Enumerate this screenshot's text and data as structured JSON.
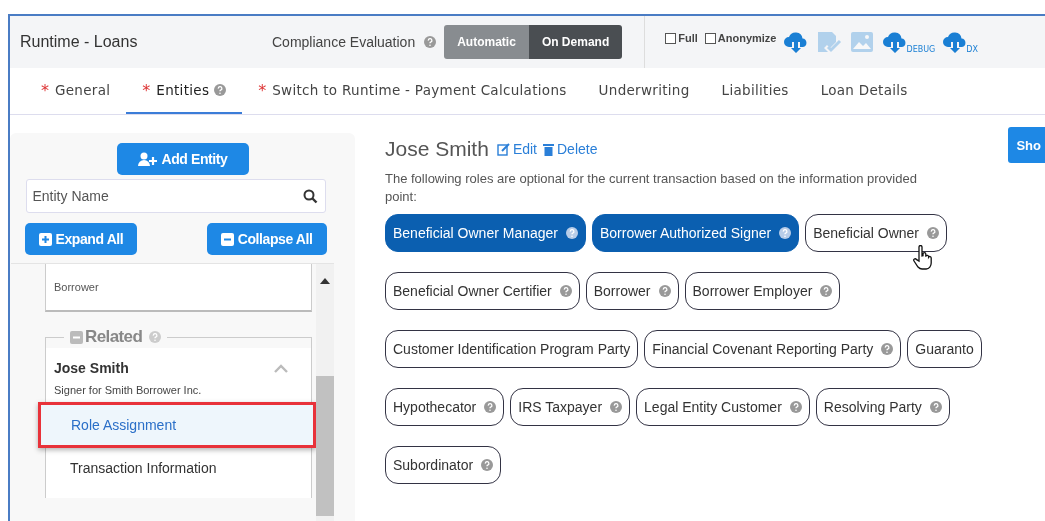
{
  "header": {
    "title": "Runtime - Loans",
    "compliance_label": "Compliance Evaluation",
    "modes": [
      {
        "label": "Automatic",
        "selected": false
      },
      {
        "label": "On Demand",
        "selected": true
      }
    ],
    "options": [
      {
        "label": "Full",
        "checked": false
      },
      {
        "label": "Anonymize",
        "checked": false
      }
    ],
    "tools": [
      {
        "kind": "cloud",
        "disabled": false
      },
      {
        "kind": "save",
        "disabled": true
      },
      {
        "kind": "image",
        "disabled": true
      },
      {
        "kind": "cloud",
        "caption": "DEBUG",
        "disabled": false
      },
      {
        "kind": "cloud",
        "caption": "DX",
        "disabled": false
      }
    ]
  },
  "tabs": [
    {
      "marker": "*",
      "label": "General",
      "help": false,
      "selected": false
    },
    {
      "marker": "*",
      "label": "Entities",
      "help": true,
      "selected": true
    },
    {
      "marker": "*",
      "label": "Switch to Runtime - Payment Calculations",
      "help": false,
      "selected": false
    },
    {
      "label": "Underwriting",
      "help": false,
      "selected": false
    },
    {
      "label": "Liabilities",
      "help": false,
      "selected": false
    },
    {
      "label": "Loan Details",
      "help": false,
      "selected": false
    }
  ],
  "sidebar": {
    "add_button": "Add Entity",
    "search": {
      "placeholder": "Entity Name"
    },
    "expand_button": "Expand All",
    "collapse_button": "Collapse All",
    "top_card": "Borrower",
    "group_label": "Related",
    "entity": {
      "name": "Jose Smith",
      "subtitle": "Signer for Smith Borrower Inc.",
      "expanded": true
    },
    "items": [
      {
        "label": "Role Assignment",
        "selected": true
      },
      {
        "label": "Transaction Information",
        "selected": false
      }
    ]
  },
  "main": {
    "name": "Jose Smith",
    "edit": "Edit",
    "delete": "Delete",
    "corner_button": "Sho",
    "description": "The following roles are optional for the current transaction based on the information provided",
    "description_2": "point:",
    "role_rows": [
      [
        {
          "label": "Beneficial Owner Manager",
          "selected": true,
          "help": true
        },
        {
          "label": "Borrower Authorized Signer",
          "selected": true,
          "help": true
        },
        {
          "label": "Beneficial Owner",
          "selected": false,
          "help": true
        }
      ],
      [
        {
          "label": "Beneficial Owner Certifier",
          "selected": false,
          "help": true
        },
        {
          "label": "Borrower",
          "selected": false,
          "help": true
        },
        {
          "label": "Borrower Employer",
          "selected": false,
          "help": true
        }
      ],
      [
        {
          "label": "Customer Identification Program Party",
          "selected": false,
          "help": false
        },
        {
          "label": "Financial Covenant Reporting Party",
          "selected": false,
          "help": true
        },
        {
          "label": "Guaranto",
          "selected": false,
          "help": false
        }
      ],
      [
        {
          "label": "Hypothecator",
          "selected": false,
          "help": true
        },
        {
          "label": "IRS Taxpayer",
          "selected": false,
          "help": true
        },
        {
          "label": "Legal Entity Customer",
          "selected": false,
          "help": true
        },
        {
          "label": "Resolving Party",
          "selected": false,
          "help": true
        }
      ],
      [
        {
          "label": "Subordinator",
          "selected": false,
          "help": true
        }
      ]
    ]
  }
}
